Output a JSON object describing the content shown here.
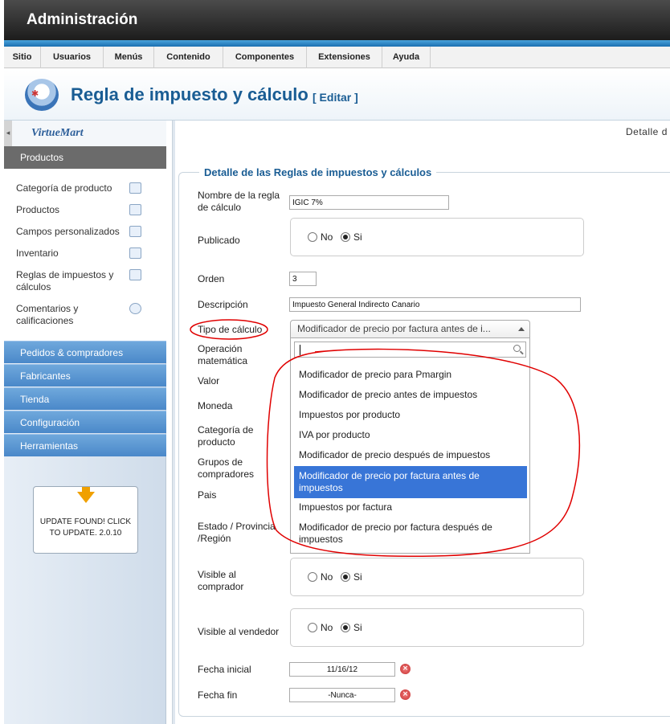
{
  "header": {
    "title": "Administración"
  },
  "menu": [
    "Sitio",
    "Usuarios",
    "Menús",
    "Contenido",
    "Componentes",
    "Extensiones",
    "Ayuda"
  ],
  "page": {
    "title": "Regla de impuesto y cálculo",
    "edit": "[ Editar ]",
    "top_right": "Detalle d"
  },
  "sidebar": {
    "brand": "VirtueMart",
    "collapse_glyph": "◂",
    "active_section": "Productos",
    "subitems": [
      {
        "label": "Categoría de producto",
        "icon": "category-icon"
      },
      {
        "label": "Productos",
        "icon": "products-icon"
      },
      {
        "label": "Campos personalizados",
        "icon": "custom-fields-icon"
      },
      {
        "label": "Inventario",
        "icon": "inventory-icon"
      },
      {
        "label": "Reglas de impuestos y cálculos",
        "icon": "tax-rules-icon"
      },
      {
        "label": "Comentarios y calificaciones",
        "icon": "comments-icon"
      }
    ],
    "sections": [
      "Pedidos & compradores",
      "Fabricantes",
      "Tienda",
      "Configuración",
      "Herramientas"
    ],
    "update": "UPDATE FOUND! CLICK TO UPDATE. 2.0.10"
  },
  "form": {
    "legend": "Detalle de las Reglas de impuestos y cálculos",
    "name_label": "Nombre de la regla de cálculo",
    "name_value": "IGIC 7%",
    "published_label": "Publicado",
    "no": "No",
    "yes": "Si",
    "order_label": "Orden",
    "order_value": "3",
    "desc_label": "Descripción",
    "desc_value": "Impuesto General Indirecto Canario",
    "calc_type_label": "Tipo de cálculo",
    "calc_type_value": "Modificador de precio por factura antes de i...",
    "math_op_label": "Operación matemática",
    "value_label": "Valor",
    "currency_label": "Moneda",
    "product_cat_label": "Categoría de producto",
    "buyer_groups_label": "Grupos de compradores",
    "country_label": "Pais",
    "state_label": "Estado / Provincia /Región",
    "visible_buyer_label": "Visible al comprador",
    "visible_seller_label": "Visible al vendedor",
    "start_date_label": "Fecha inicial",
    "start_date_value": "11/16/12",
    "end_date_label": "Fecha fin",
    "end_date_value": "-Nunca-",
    "clear_glyph": "×"
  },
  "dropdown": {
    "options": [
      "Modificador de precio para Pmargin",
      "Modificador de precio antes de impuestos",
      "Impuestos por producto",
      "IVA por producto",
      "Modificador de precio después de impuestos",
      "Modificador de precio por factura antes de impuestos",
      "Impuestos por factura",
      "Modificador de precio por factura después de impuestos"
    ],
    "selected_index": 5
  },
  "colors": {
    "accent": "#1a5d94",
    "selected": "#3875d7",
    "annotation": "#e00000"
  }
}
